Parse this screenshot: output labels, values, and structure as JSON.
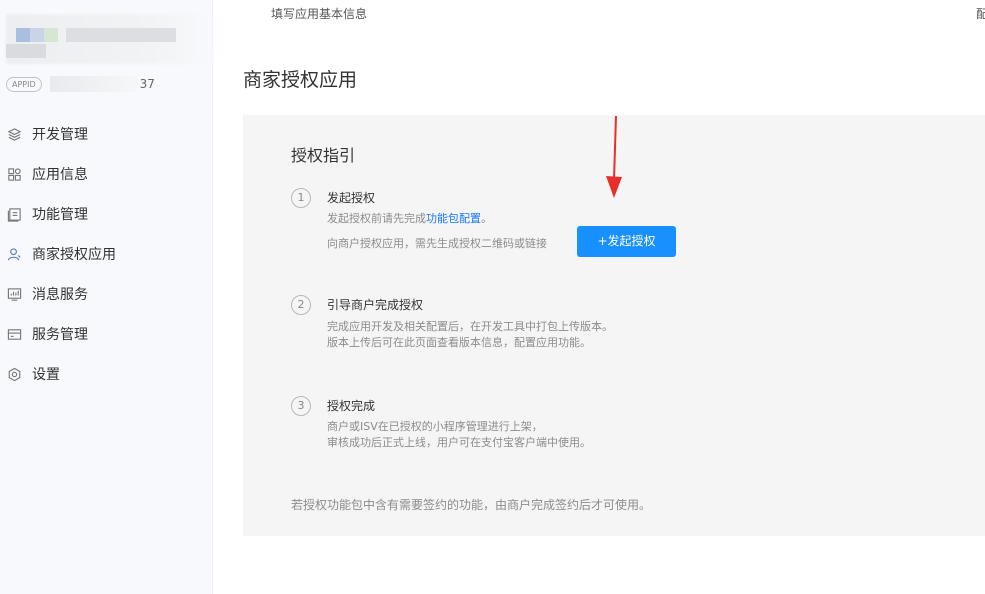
{
  "sidebar": {
    "appid_badge": "APPID",
    "appid_suffix": "37",
    "items": [
      {
        "label": "开发管理",
        "icon": "layers-icon"
      },
      {
        "label": "应用信息",
        "icon": "grid-icon"
      },
      {
        "label": "功能管理",
        "icon": "document-icon"
      },
      {
        "label": "商家授权应用",
        "icon": "user-icon"
      },
      {
        "label": "消息服务",
        "icon": "chart-icon"
      },
      {
        "label": "服务管理",
        "icon": "card-icon"
      },
      {
        "label": "设置",
        "icon": "gear-icon"
      }
    ]
  },
  "topbar": {
    "tab_label": "填写应用基本信息",
    "right_label": "配"
  },
  "page": {
    "title": "商家授权应用"
  },
  "guide": {
    "title": "授权指引",
    "steps": [
      {
        "number": "1",
        "title": "发起授权",
        "desc_prefix": "发起授权前请先完成",
        "desc_link": "功能包配置",
        "desc_suffix": "。",
        "desc_line2": "向商户授权应用，需先生成授权二维码或链接",
        "button_label": "+发起授权"
      },
      {
        "number": "2",
        "title": "引导商户完成授权",
        "desc_line1": "完成应用开发及相关配置后，在开发工具中打包上传版本。",
        "desc_line2": "版本上传后可在此页面查看版本信息，配置应用功能。"
      },
      {
        "number": "3",
        "title": "授权完成",
        "desc_line1": "商户或ISV在已授权的小程序管理进行上架，",
        "desc_line2": "审核成功后正式上线，用户可在支付宝客户端中使用。"
      }
    ],
    "footnote": "若授权功能包中含有需要签约的功能，由商户完成签约后才可使用。"
  },
  "colors": {
    "accent": "#1890ff",
    "arrow": "#e8302a"
  }
}
